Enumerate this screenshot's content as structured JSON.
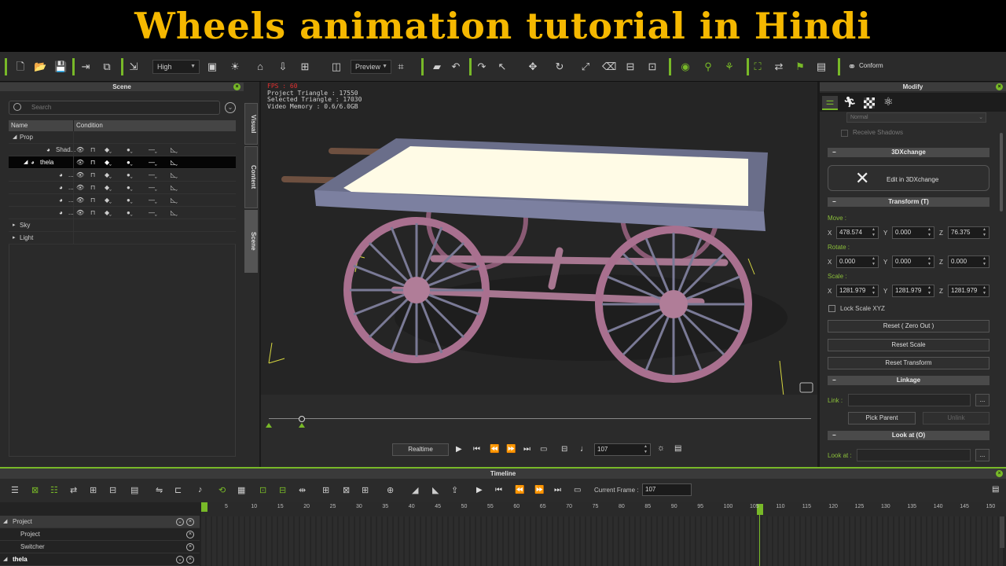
{
  "banner": {
    "title": "Wheels animation tutorial in Hindi",
    "color": "#f5b800"
  },
  "toolbar": {
    "quality": "High",
    "preview": "Preview",
    "conform": "Conform",
    "accent": "#78b928",
    "icons": [
      "new-icon",
      "open-icon",
      "save-icon",
      "export-icon",
      "render-icon",
      "import-icon",
      "layout-icon",
      "light-icon",
      "home-icon",
      "download-icon",
      "fit-icon",
      "shadow-icon",
      "screenshot-icon",
      "camera-icon",
      "undo-icon",
      "redo-icon",
      "select-icon",
      "move-icon",
      "rotate-icon",
      "scale-icon",
      "eraser-icon",
      "align-icon",
      "palette-icon",
      "visibility-icon",
      "physics-icon",
      "leaf-icon",
      "network-icon",
      "transfer-icon",
      "flag-icon",
      "clipboard-icon",
      "link-icon"
    ]
  },
  "scene": {
    "title": "Scene",
    "search_placeholder": "Search",
    "col_name": "Name",
    "col_condition": "Condition",
    "rows": [
      {
        "label": "Prop",
        "indent": 0
      },
      {
        "label": "Shad...",
        "indent": 2
      },
      {
        "label": "thela",
        "indent": 1,
        "selected": true
      },
      {
        "label": "...",
        "indent": 3
      },
      {
        "label": "...",
        "indent": 3
      },
      {
        "label": "...",
        "indent": 3
      },
      {
        "label": "...",
        "indent": 3
      },
      {
        "label": "Sky",
        "indent": 0
      },
      {
        "label": "Light",
        "indent": 0
      }
    ],
    "side_tabs": [
      "Visual",
      "Content",
      "Scene"
    ]
  },
  "viewport": {
    "fps": "FPS : 60",
    "project_triangle": "Project Triangle : 17550",
    "selected_triangle": "Selected Triangle : 17030",
    "video_memory": "Video Memory : 0.6/6.0GB",
    "realtime": "Realtime",
    "frame": "107"
  },
  "modify": {
    "title": "Modify",
    "normal": "Normal",
    "receive_shadows": "Receive Shadows",
    "sec_3dx": "3DXchange",
    "edit_3dx": "Edit in 3DXchange",
    "sec_transform": "Transform  (T)",
    "move_label": "Move :",
    "move": {
      "x": "478.574",
      "y": "0.000",
      "z": "76.375"
    },
    "rotate_label": "Rotate :",
    "rotate": {
      "x": "0.000",
      "y": "0.000",
      "z": "0.000"
    },
    "scale_label": "Scale :",
    "scale": {
      "x": "1281.979",
      "y": "1281.979",
      "z": "1281.979"
    },
    "lock_scale": "Lock Scale XYZ",
    "reset_zero": "Reset ( Zero Out )",
    "reset_scale": "Reset Scale",
    "reset_transform": "Reset Transform",
    "sec_linkage": "Linkage",
    "link_label": "Link :",
    "pick_parent": "Pick Parent",
    "unlink": "Unlink",
    "sec_lookat": "Look at  (O)",
    "lookat_label": "Look at :"
  },
  "timeline": {
    "title": "Timeline",
    "current_frame_label": "Current Frame :",
    "current_frame": "107",
    "ticks": [
      "5",
      "10",
      "15",
      "20",
      "25",
      "30",
      "35",
      "40",
      "45",
      "50",
      "55",
      "60",
      "65",
      "70",
      "75",
      "80",
      "85",
      "90",
      "95",
      "100",
      "105",
      "110",
      "115",
      "120",
      "125",
      "130",
      "135",
      "140",
      "145",
      "150"
    ],
    "rows": [
      {
        "label": "Project",
        "indent": 0
      },
      {
        "label": "Project",
        "indent": 1
      },
      {
        "label": "Switcher",
        "indent": 1
      },
      {
        "label": "thela",
        "indent": 0
      }
    ]
  }
}
